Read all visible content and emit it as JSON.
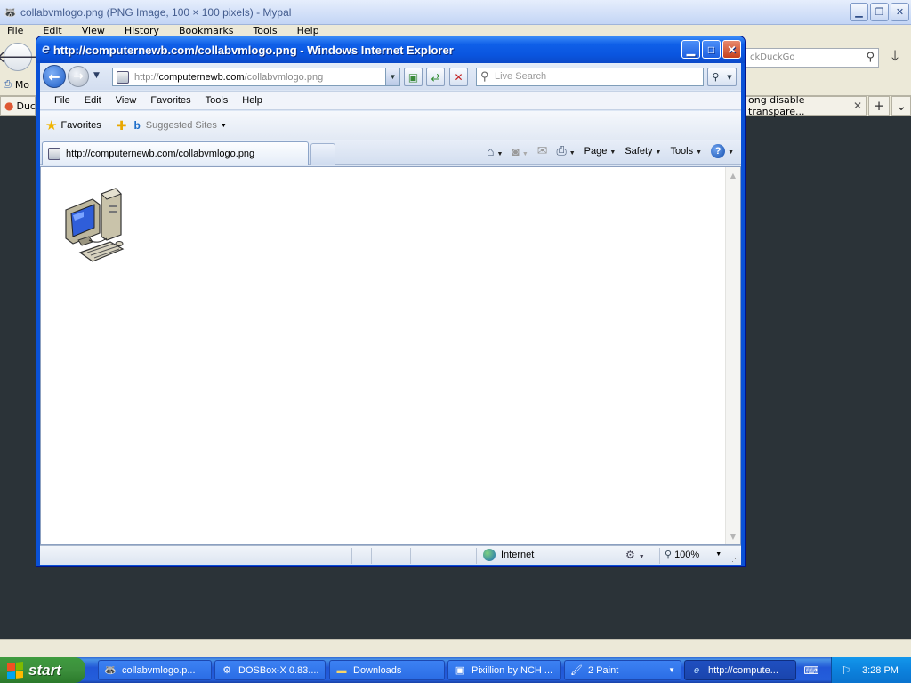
{
  "mypal": {
    "title": "collabvmlogo.png (PNG Image, 100 × 100 pixels) - Mypal",
    "menu": [
      "File",
      "Edit",
      "View",
      "History",
      "Bookmarks",
      "Tools",
      "Help"
    ],
    "search_text": "ckDuckGo",
    "bookmark_label": "Mo",
    "tab_left": "Duc",
    "tab_right": "ong disable transpare..."
  },
  "ie": {
    "title": "http://computernewb.com/collabvmlogo.png - Windows Internet Explorer",
    "address": {
      "scheme": "http://",
      "host": "computernewb.com",
      "path": "/collabvmlogo.png"
    },
    "search_placeholder": "Live Search",
    "menu": [
      "File",
      "Edit",
      "View",
      "Favorites",
      "Tools",
      "Help"
    ],
    "favorites_label": "Favorites",
    "suggested_sites": "Suggested Sites",
    "tab_label": "http://computernewb.com/collabvmlogo.png",
    "commands": {
      "page": "Page",
      "safety": "Safety",
      "tools": "Tools"
    },
    "status": {
      "zone": "Internet",
      "zoom": "100%"
    }
  },
  "taskbar": {
    "start": "start",
    "tasks": [
      {
        "label": "collabvmlogo.p..."
      },
      {
        "label": "DOSBox-X 0.83...."
      },
      {
        "label": "Downloads"
      },
      {
        "label": "Pixillion by NCH ..."
      },
      {
        "label": "2 Paint"
      },
      {
        "label": "http://compute..."
      }
    ],
    "clock": "3:28 PM"
  }
}
